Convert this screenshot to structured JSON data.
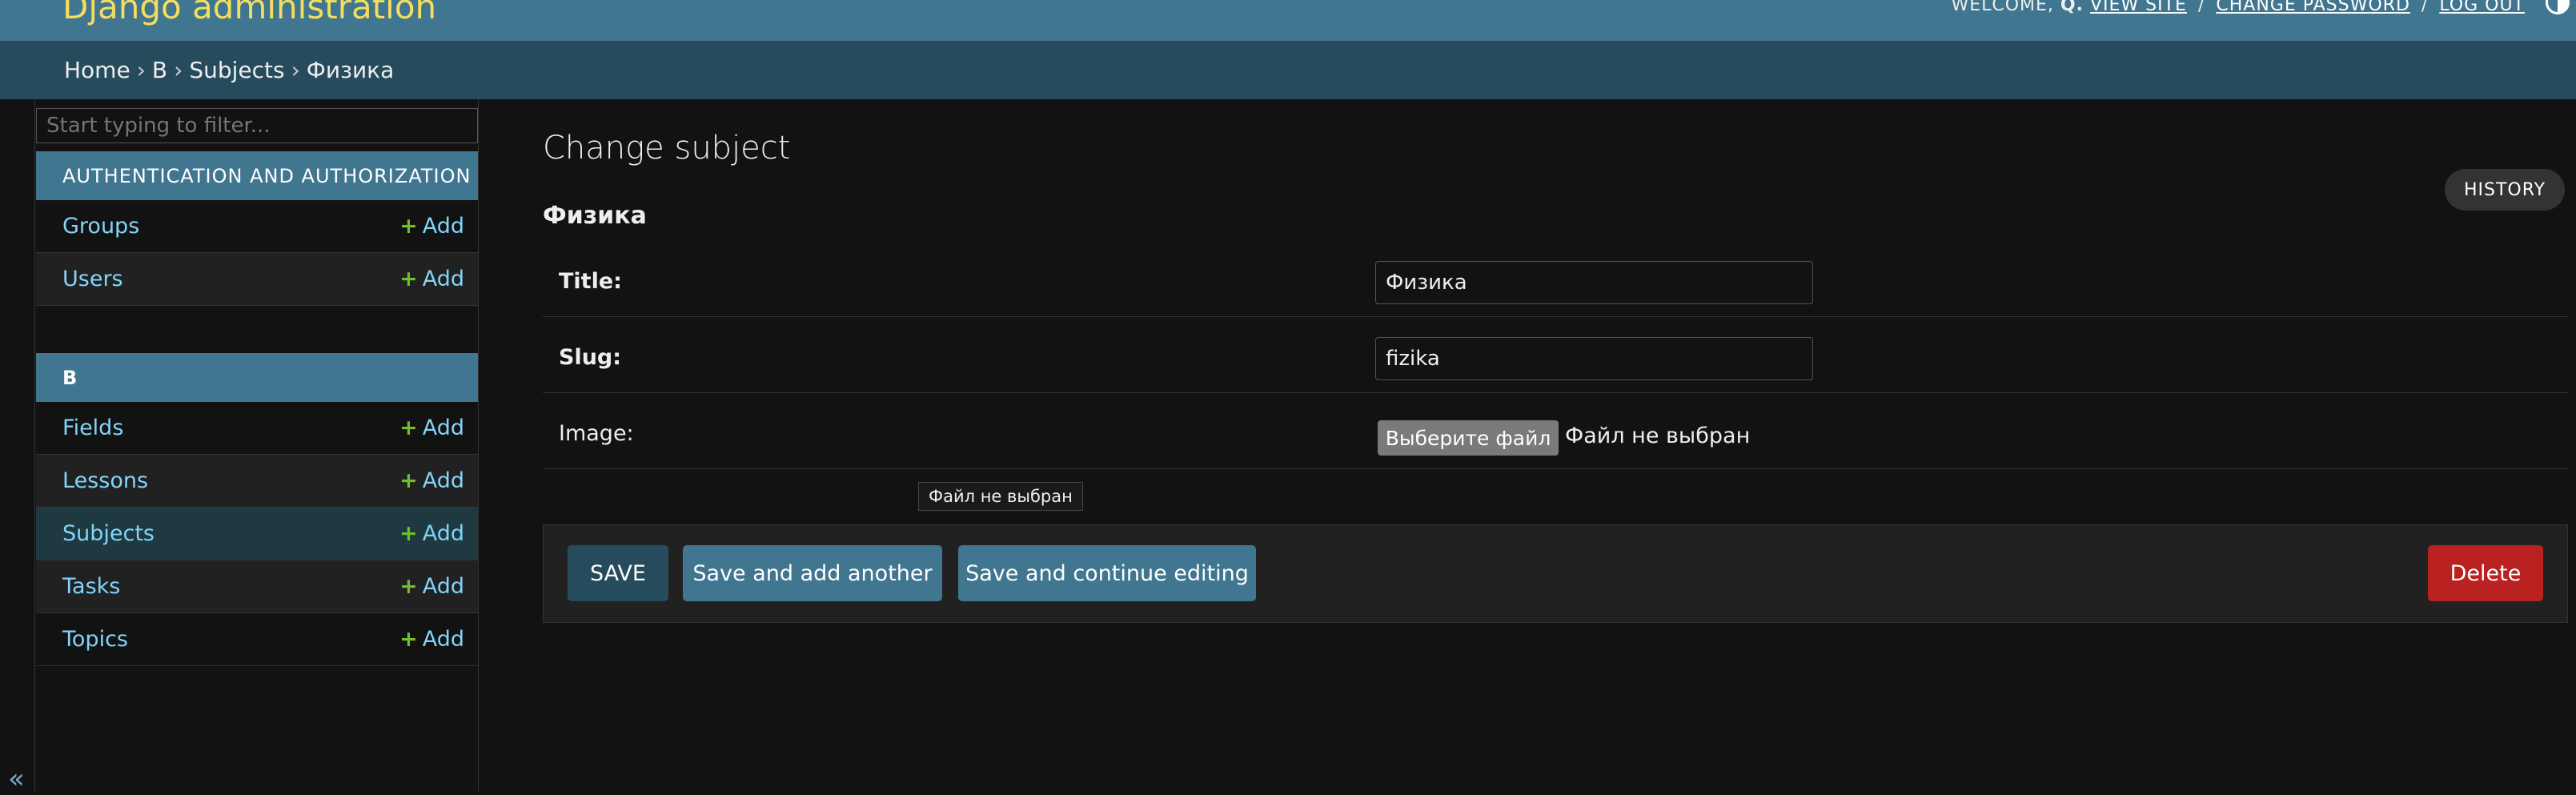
{
  "header": {
    "branding": "Django administration",
    "welcome": "WELCOME,",
    "user": "Q.",
    "view_site": "VIEW SITE",
    "change_password": "CHANGE PASSWORD",
    "log_out": "LOG OUT",
    "separator": "/"
  },
  "breadcrumbs": {
    "items": [
      "Home",
      "B",
      "Subjects",
      "Физика"
    ],
    "separator": "›"
  },
  "sidebar": {
    "filter_placeholder": "Start typing to filter...",
    "add_label": "Add",
    "add_symbol": "+",
    "collapse_symbol": "«",
    "apps": [
      {
        "caption": "AUTHENTICATION AND AUTHORIZATION",
        "models": [
          {
            "name": "Groups",
            "selected": false
          },
          {
            "name": "Users",
            "selected": false
          }
        ]
      },
      {
        "caption": "B",
        "models": [
          {
            "name": "Fields",
            "selected": false
          },
          {
            "name": "Lessons",
            "selected": false
          },
          {
            "name": "Subjects",
            "selected": true
          },
          {
            "name": "Tasks",
            "selected": false
          },
          {
            "name": "Topics",
            "selected": false
          }
        ]
      }
    ]
  },
  "content": {
    "title": "Change subject",
    "object_name": "Физика",
    "history_label": "HISTORY",
    "fields": {
      "title_label": "Title:",
      "title_value": "Физика",
      "slug_label": "Slug:",
      "slug_value": "fizika",
      "image_label": "Image:",
      "file_button": "Выберите файл",
      "file_status": "Файл не выбран",
      "tooltip": "Файл не выбран"
    },
    "buttons": {
      "save": "SAVE",
      "save_add_another": "Save and add another",
      "save_continue": "Save and continue editing",
      "delete": "Delete"
    }
  },
  "colors": {
    "header": "#417690",
    "breadcrumbs": "#264b5d",
    "branding": "#f5dd5d",
    "link": "#81d4fa",
    "add_plus": "#70bf2b",
    "delete": "#ba2121",
    "selected_row": "#1e3a40"
  }
}
